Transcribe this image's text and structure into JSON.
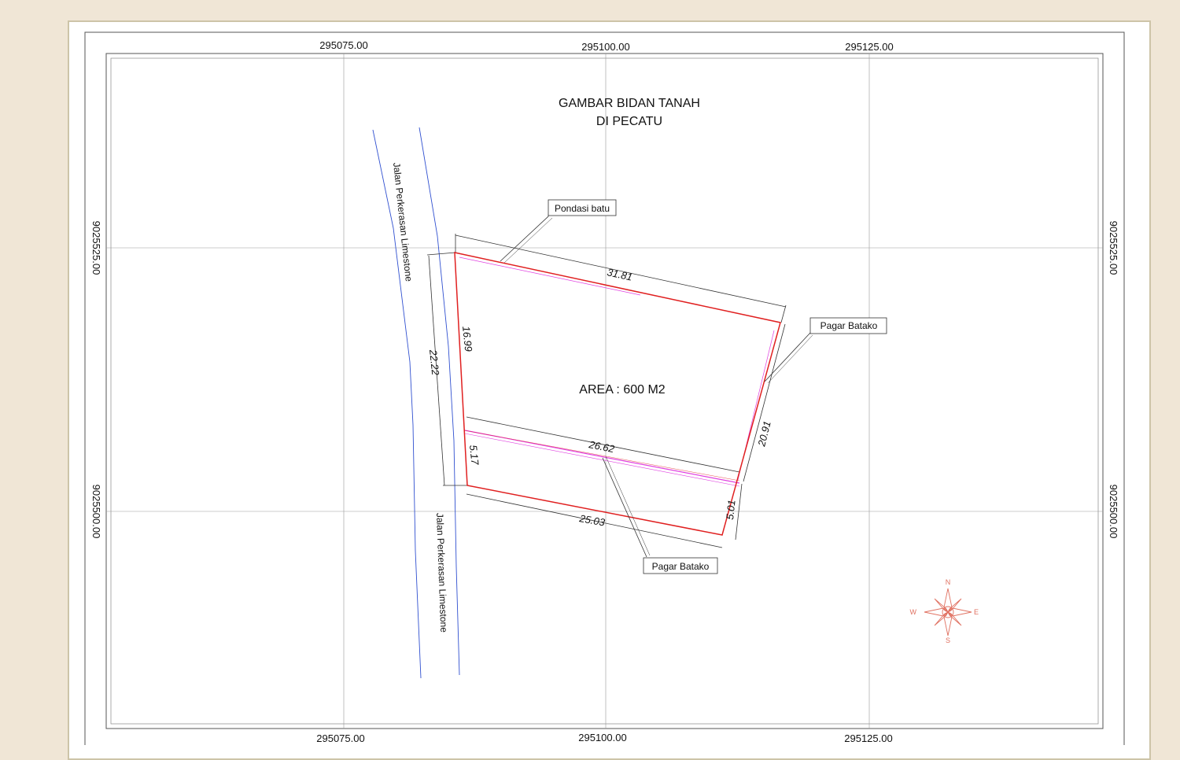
{
  "drawing": {
    "title_line1": "GAMBAR BIDAN TANAH",
    "title_line2": "DI PECATU",
    "area_label": "AREA : 600 M2"
  },
  "grid": {
    "easting_top": [
      "295075.00",
      "295100.00",
      "295125.00"
    ],
    "easting_bottom": [
      "295075.00",
      "295100.00",
      "295125.00"
    ],
    "northing_left": [
      "9025525.00",
      "9025500.00"
    ],
    "northing_right": [
      "9025525.00",
      "9025500.00"
    ]
  },
  "dimensions": {
    "north_edge": "31.81",
    "west_upper": "16.99",
    "west_total": "22.22",
    "fence_line": "26.62",
    "west_lower": "5.17",
    "east_upper": "20.91",
    "east_lower": "5.01",
    "south_edge": "25.03"
  },
  "callouts": {
    "pondasi": "Pondasi batu",
    "pagar_east": "Pagar Batako",
    "pagar_south": "Pagar Batako"
  },
  "roads": {
    "upper": "Jalan Perkerasan Limestone",
    "lower": "Jalan Perkerasan Limestone"
  },
  "compass": {
    "n": "N",
    "s": "S",
    "e": "E",
    "w": "W"
  },
  "colors": {
    "parcel_boundary": "#e02020",
    "fence_inner": "#e040e0",
    "road_edge": "#3050d0",
    "compass": "#e07060"
  }
}
